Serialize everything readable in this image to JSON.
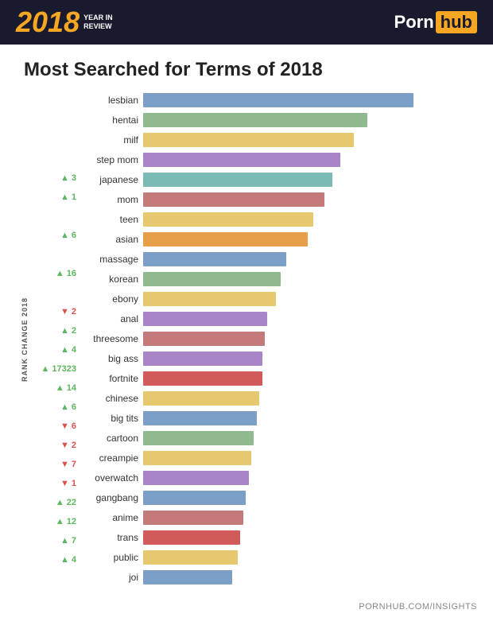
{
  "header": {
    "year": "2018",
    "year_sub_line1": "YEAR IN",
    "year_sub_line2": "REVIEW",
    "logo_porn": "Porn",
    "logo_hub": "hub"
  },
  "title": "Most Searched for Terms of 2018",
  "yaxis_label": "RANK CHANGE 2018",
  "footer": "PORNHUB.COM/INSIGHTS",
  "bars": [
    {
      "label": "lesbian",
      "pct": 100,
      "color": "#7b9fc7",
      "rank": "",
      "dir": ""
    },
    {
      "label": "hentai",
      "pct": 83,
      "color": "#8fba8f",
      "rank": "",
      "dir": ""
    },
    {
      "label": "milf",
      "pct": 78,
      "color": "#e6c86e",
      "rank": "",
      "dir": ""
    },
    {
      "label": "step mom",
      "pct": 73,
      "color": "#a885c7",
      "rank": "",
      "dir": ""
    },
    {
      "label": "japanese",
      "pct": 70,
      "color": "#7bbab5",
      "rank": "3",
      "dir": "up"
    },
    {
      "label": "mom",
      "pct": 67,
      "color": "#c47a7a",
      "rank": "1",
      "dir": "up"
    },
    {
      "label": "teen",
      "pct": 63,
      "color": "#e6c86e",
      "rank": "",
      "dir": ""
    },
    {
      "label": "asian",
      "pct": 61,
      "color": "#e6a04a",
      "rank": "6",
      "dir": "up"
    },
    {
      "label": "massage",
      "pct": 53,
      "color": "#7b9fc7",
      "rank": "",
      "dir": ""
    },
    {
      "label": "korean",
      "pct": 51,
      "color": "#8fba8f",
      "rank": "16",
      "dir": "up"
    },
    {
      "label": "ebony",
      "pct": 49,
      "color": "#e6c86e",
      "rank": "",
      "dir": ""
    },
    {
      "label": "anal",
      "pct": 46,
      "color": "#a885c7",
      "rank": "2",
      "dir": "down"
    },
    {
      "label": "threesome",
      "pct": 45,
      "color": "#c47a7a",
      "rank": "2",
      "dir": "up"
    },
    {
      "label": "big ass",
      "pct": 44,
      "color": "#a885c7",
      "rank": "4",
      "dir": "up"
    },
    {
      "label": "fortnite",
      "pct": 44,
      "color": "#d05a5a",
      "rank": "17323",
      "dir": "up"
    },
    {
      "label": "chinese",
      "pct": 43,
      "color": "#e6c86e",
      "rank": "14",
      "dir": "up"
    },
    {
      "label": "big tits",
      "pct": 42,
      "color": "#7b9fc7",
      "rank": "6",
      "dir": "up"
    },
    {
      "label": "cartoon",
      "pct": 41,
      "color": "#8fba8f",
      "rank": "6",
      "dir": "down"
    },
    {
      "label": "creampie",
      "pct": 40,
      "color": "#e6c86e",
      "rank": "2",
      "dir": "down"
    },
    {
      "label": "overwatch",
      "pct": 39,
      "color": "#a885c7",
      "rank": "7",
      "dir": "down"
    },
    {
      "label": "gangbang",
      "pct": 38,
      "color": "#7b9fc7",
      "rank": "1",
      "dir": "down"
    },
    {
      "label": "anime",
      "pct": 37,
      "color": "#c47a7a",
      "rank": "22",
      "dir": "up"
    },
    {
      "label": "trans",
      "pct": 36,
      "color": "#d05a5a",
      "rank": "12",
      "dir": "up"
    },
    {
      "label": "public",
      "pct": 35,
      "color": "#e6c86e",
      "rank": "7",
      "dir": "up"
    },
    {
      "label": "joi",
      "pct": 33,
      "color": "#7b9fc7",
      "rank": "4",
      "dir": "up"
    }
  ]
}
